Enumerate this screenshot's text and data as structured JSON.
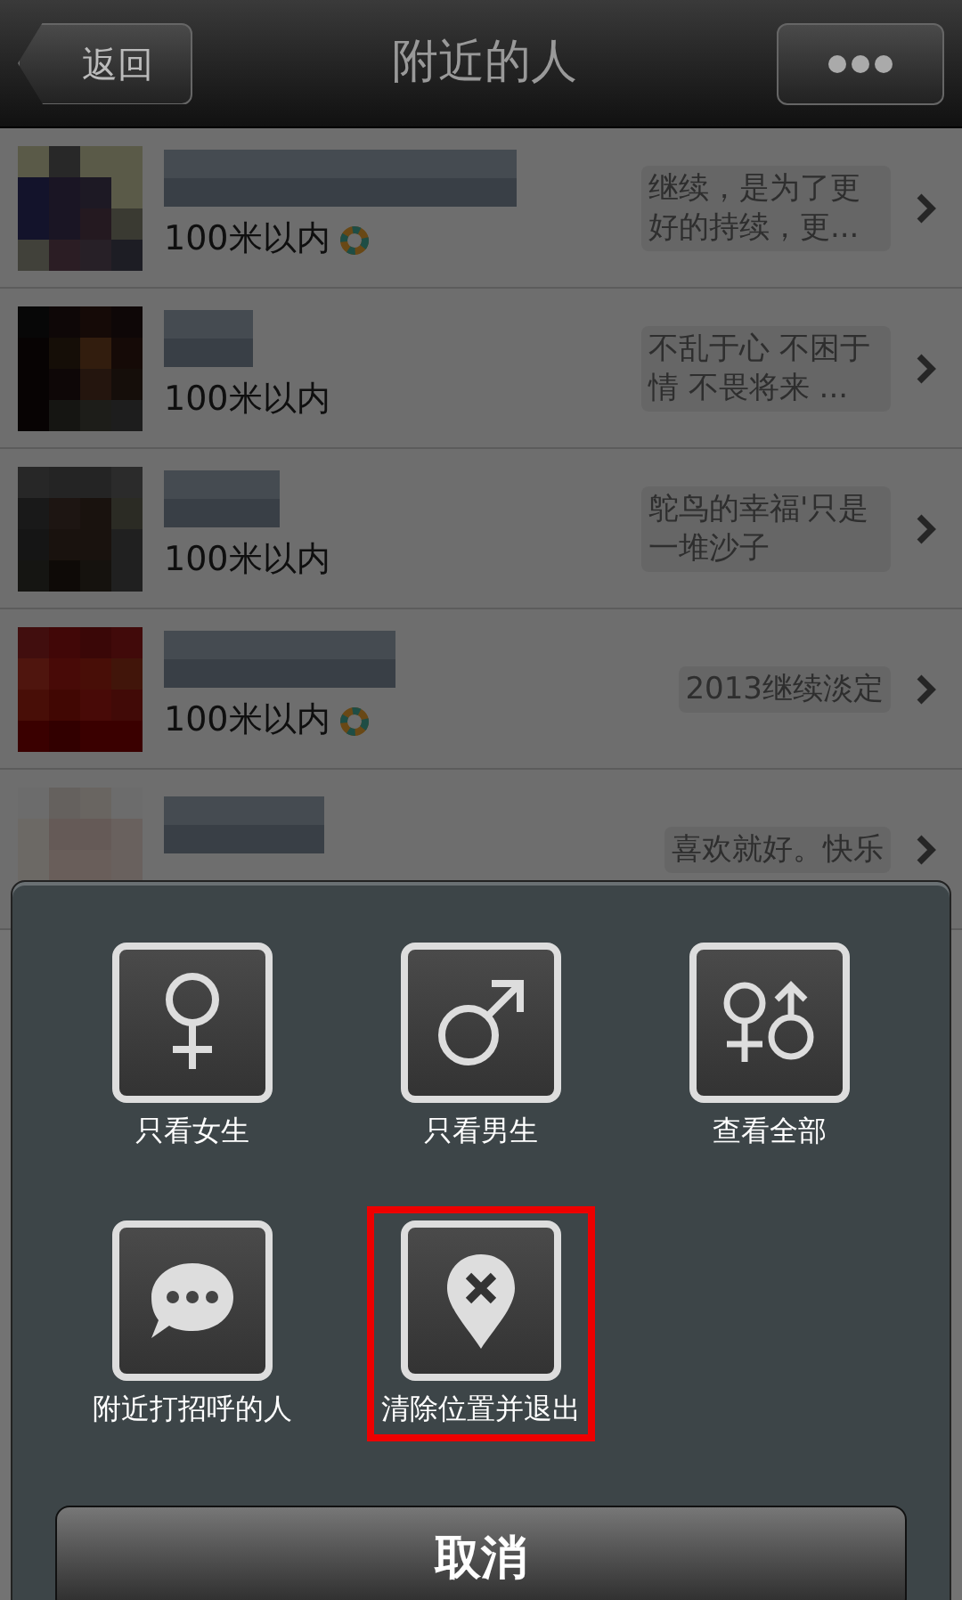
{
  "header": {
    "back": "返回",
    "title": "附近的人"
  },
  "people": [
    {
      "distance": "100米以内",
      "badge": true,
      "status": "继续，是为了更好的持续，更..."
    },
    {
      "distance": "100米以内",
      "badge": false,
      "status": "不乱于心  不困于情  不畏将来  ..."
    },
    {
      "distance": "100米以内",
      "badge": false,
      "status": "鸵鸟的幸福'只是一堆沙子"
    },
    {
      "distance": "100米以内",
      "badge": true,
      "status": "2013继续淡定"
    },
    {
      "status": "喜欢就好。快乐"
    }
  ],
  "sheet": {
    "actions": [
      {
        "kind": "female",
        "label": "只看女生",
        "highlighted": false
      },
      {
        "kind": "male",
        "label": "只看男生",
        "highlighted": false
      },
      {
        "kind": "all",
        "label": "查看全部",
        "highlighted": false
      },
      {
        "kind": "greet",
        "label": "附近打招呼的人",
        "highlighted": false
      },
      {
        "kind": "clear",
        "label": "清除位置并退出",
        "highlighted": true
      }
    ],
    "cancel": "取消"
  }
}
